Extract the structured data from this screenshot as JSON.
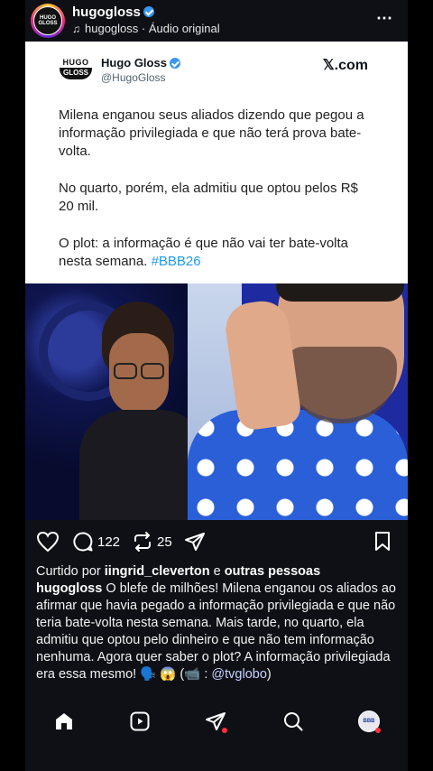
{
  "header": {
    "avatar_text": "HUGO\nGLOSS",
    "username": "hugogloss",
    "audio_user": "hugogloss",
    "audio_separator": " · ",
    "audio_label": "Áudio original"
  },
  "tweet": {
    "logo_top": "HUGO",
    "logo_bottom": "GLOSS",
    "name": "Hugo Gloss",
    "handle": "@HugoGloss",
    "brand": "𝕏.com",
    "paragraph1": "Milena enganou seus aliados dizendo que pegou a informação privilegiada e que não terá prova bate-volta.",
    "paragraph2": "No quarto, porém, ela admitiu que optou pelos R$ 20 mil.",
    "paragraph3": "O plot: a informação é que não vai ter bate-volta nesta semana.",
    "hashtag": "#BBB26"
  },
  "actions": {
    "comments": "122",
    "reposts": "25"
  },
  "caption": {
    "liked_prefix": "Curtido por",
    "liked_user": "iingrid_cleverton",
    "liked_and": "e",
    "liked_others": "outras pessoas",
    "username": "hugogloss",
    "text": "O blefe de milhões! Milena enganou os aliados ao afirmar que havia pegado a informação privilegiada e que não teria bate-volta nesta semana. Mais tarde, no quarto, ela admitiu que optou pelo dinheiro e que não tem informação nenhuma. Agora quer saber o plot? A informação privilegiada era essa mesmo!",
    "emojis": "🗣️ 😱",
    "credit_prefix": "(📹 :",
    "credit_mention": "@tvglobo",
    "credit_suffix": ")"
  },
  "nav": {
    "profile_text": "BBB"
  },
  "colors": {
    "background": "#0f1015",
    "verified": "#3897f0",
    "hashtag": "#1d9bf0",
    "notification_dot": "#ff3040"
  }
}
